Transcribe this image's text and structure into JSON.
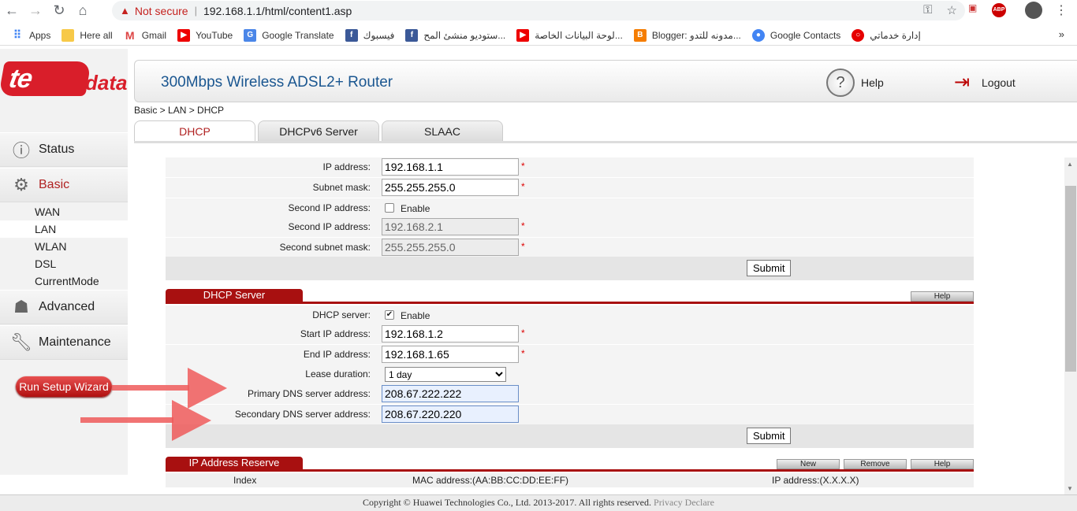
{
  "browser": {
    "not_secure": "Not secure",
    "url": "192.168.1.1/html/content1.asp",
    "bookmarks": [
      "Apps",
      "Here all",
      "Gmail",
      "YouTube",
      "Google Translate",
      "فيسبوك",
      "ستوديو منشئ المح...",
      "لوحة البيانات الخاصة...",
      "Blogger: مدونه للتدو...",
      "Google Contacts",
      "إدارة خدماتي"
    ],
    "more": "»"
  },
  "header": {
    "logo_te": "te",
    "logo_data": "data",
    "title": "300Mbps Wireless ADSL2+ Router",
    "help": "Help",
    "logout": "Logout"
  },
  "sidebar": {
    "items": [
      {
        "label": "Status",
        "icon": "status-icon"
      },
      {
        "label": "Basic",
        "icon": "gear-icon"
      },
      {
        "label": "Advanced",
        "icon": "advanced-icon"
      },
      {
        "label": "Maintenance",
        "icon": "wrench-icon"
      }
    ],
    "submenu": [
      "WAN",
      "LAN",
      "WLAN",
      "DSL",
      "CurrentMode"
    ],
    "wizard": "Run Setup Wizard"
  },
  "breadcrumb": "Basic > LAN > DHCP",
  "tabs": [
    "DHCP",
    "DHCPv6 Server",
    "SLAAC"
  ],
  "lan": {
    "ip_label": "IP address:",
    "ip_value": "192.168.1.1",
    "mask_label": "Subnet mask:",
    "mask_value": "255.255.255.0",
    "second_ip_label": "Second IP address:",
    "enable_label": "Enable",
    "second_ip2_label": "Second IP address:",
    "second_ip_value": "192.168.2.1",
    "second_mask_label": "Second subnet mask:",
    "second_mask_value": "255.255.255.0",
    "required": "*",
    "submit": "Submit"
  },
  "dhcp": {
    "section_title": "DHCP Server",
    "help": "Help",
    "server_label": "DHCP server:",
    "enable_label": "Enable",
    "start_label": "Start IP address:",
    "start_value": "192.168.1.2",
    "end_label": "End IP address:",
    "end_value": "192.168.1.65",
    "lease_label": "Lease duration:",
    "lease_value": "1 day",
    "primary_dns_label": "Primary DNS server address:",
    "primary_dns_value": "208.67.222.222",
    "secondary_dns_label": "Secondary DNS server address:",
    "secondary_dns_value": "208.67.220.220",
    "submit": "Submit"
  },
  "reserve": {
    "section_title": "IP Address Reserve",
    "new": "New",
    "remove": "Remove",
    "help": "Help",
    "columns": [
      "Index",
      "MAC address:(AA:BB:CC:DD:EE:FF)",
      "IP address:(X.X.X.X)"
    ]
  },
  "footer": {
    "copyright": "Copyright © Huawei Technologies Co., Ltd. 2013-2017. All rights reserved.",
    "privacy": "Privacy Declare"
  }
}
